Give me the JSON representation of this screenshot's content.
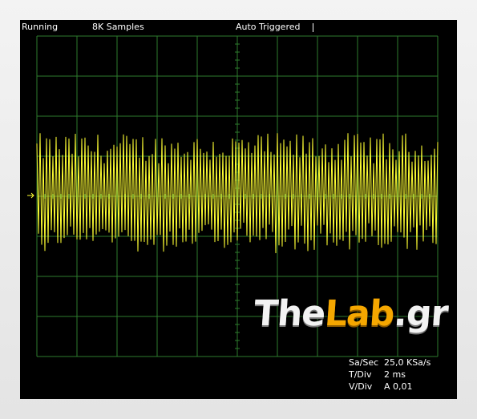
{
  "status_bar": {
    "run_state": "Running",
    "samples": "8K Samples",
    "trigger": "Auto Triggered"
  },
  "readouts": {
    "sample_rate_label": "Sa/Sec",
    "sample_rate_value": "25,0 KSa/s",
    "time_div_label": "T/Div",
    "time_div_value": "2 ms",
    "volt_div_label": "V/Div",
    "volt_div_value": "A 0,01"
  },
  "watermark": {
    "part1": "The",
    "part2": "Lab",
    "part3": ".gr"
  },
  "colors": {
    "trace": "#ffff33",
    "grid": "#2e7d2e",
    "background": "#000000",
    "logo_accent": "#f5a700"
  },
  "icons": {
    "ground_marker": "arrow-right-icon",
    "trigger_marker": "vertical-bar-icon"
  }
}
